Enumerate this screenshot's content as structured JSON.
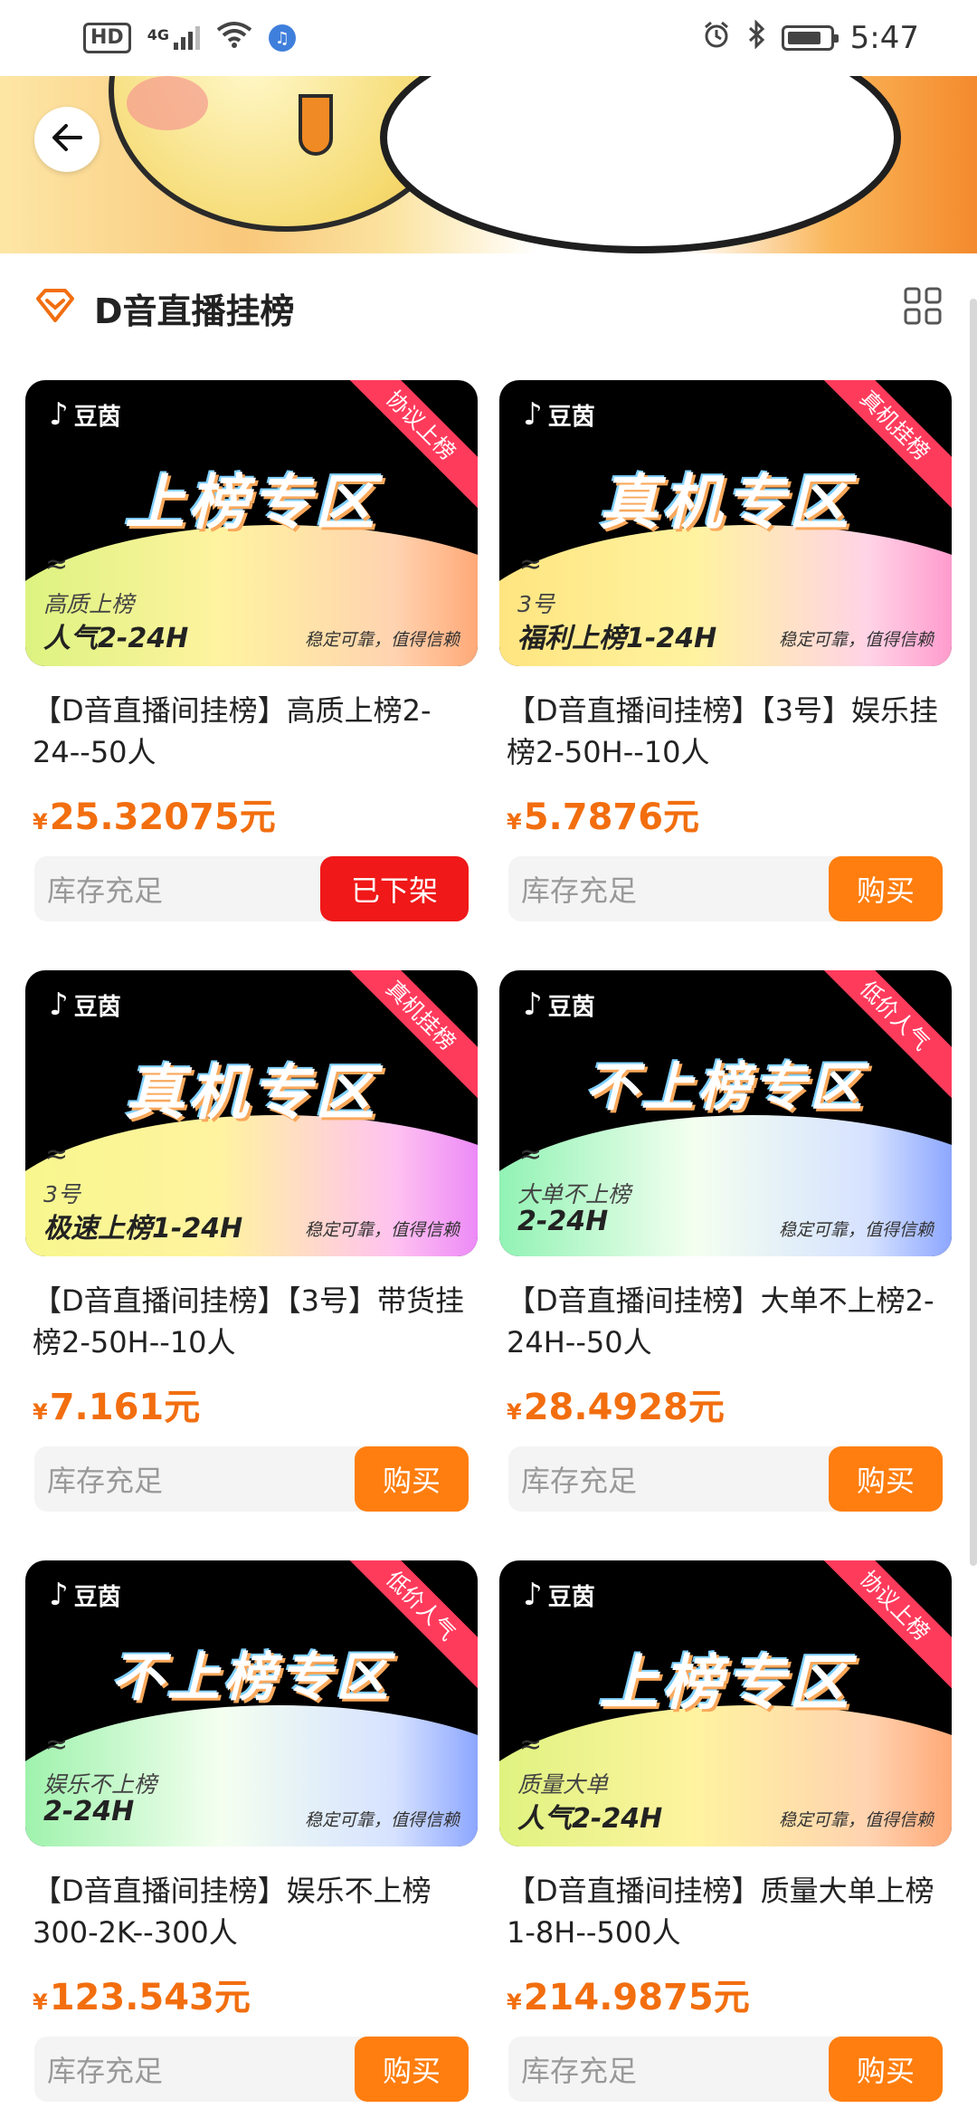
{
  "status_bar": {
    "left_icons": [
      "hd-icon",
      "signal-4g-icon",
      "wifi-icon",
      "music-app-icon"
    ],
    "hd": "HD",
    "network": "4G",
    "time": "5:47",
    "right_icons": [
      "alarm-icon",
      "bluetooth-icon",
      "battery-icon"
    ]
  },
  "header": {
    "back": "back-arrow-icon"
  },
  "section": {
    "title": "D音直播挂榜",
    "view_toggle": "grid-view-icon"
  },
  "products": [
    {
      "thumb": {
        "logo": "豆茵",
        "zone": "上榜专区",
        "ribbon": "协议上榜",
        "sub": "高质上榜",
        "main": "人气2-24H",
        "trust": "稳定可靠，值得信赖",
        "wave_color": "#d6f37a"
      },
      "name": "【D音直播间挂榜】高质上榜2-24--50人",
      "price": "25.32075元",
      "stock": "库存充足",
      "button": "已下架",
      "button_type": "off"
    },
    {
      "thumb": {
        "logo": "豆茵",
        "zone": "真机专区",
        "ribbon": "真机挂榜",
        "sub": "3号",
        "main": "福利上榜1-24H",
        "trust": "稳定可靠，值得信赖",
        "wave_color": "#ffe27a"
      },
      "name": "【D音直播间挂榜】【3号】娱乐挂榜2-50H--10人",
      "price": "5.7876元",
      "stock": "库存充足",
      "button": "购买",
      "button_type": "buy"
    },
    {
      "thumb": {
        "logo": "豆茵",
        "zone": "真机专区",
        "ribbon": "真机挂榜",
        "sub": "3号",
        "main": "极速上榜1-24H",
        "trust": "稳定可靠，值得信赖",
        "wave_color": "#f6f88a"
      },
      "name": "【D音直播间挂榜】【3号】带货挂榜2-50H--10人",
      "price": "7.161元",
      "stock": "库存充足",
      "button": "购买",
      "button_type": "buy"
    },
    {
      "thumb": {
        "logo": "豆茵",
        "zone": "不上榜专区",
        "ribbon": "低价人气",
        "sub": "大单不上榜",
        "main": "2-24H",
        "trust": "稳定可靠，值得信赖",
        "wave_color": "#7ff0a9"
      },
      "name": "【D音直播间挂榜】大单不上榜2-24H--50人",
      "price": "28.4928元",
      "stock": "库存充足",
      "button": "购买",
      "button_type": "buy"
    },
    {
      "thumb": {
        "logo": "豆茵",
        "zone": "不上榜专区",
        "ribbon": "低价人气",
        "sub": "娱乐不上榜",
        "main": "2-24H",
        "trust": "稳定可靠，值得信赖",
        "wave_color": "#8ff0a0"
      },
      "name": "【D音直播间挂榜】娱乐不上榜300-2K--300人",
      "price": "123.543元",
      "stock": "库存充足",
      "button": "购买",
      "button_type": "buy"
    },
    {
      "thumb": {
        "logo": "豆茵",
        "zone": "上榜专区",
        "ribbon": "协议上榜",
        "sub": "质量大单",
        "main": "人气2-24H",
        "trust": "稳定可靠，值得信赖",
        "wave_color": "#d9f37a"
      },
      "name": "【D音直播间挂榜】质量大单上榜1-8H--500人",
      "price": "214.9875元",
      "stock": "库存充足",
      "button": "购买",
      "button_type": "buy"
    }
  ],
  "currency_symbol": "¥",
  "colors": {
    "accent_orange": "#ff7e0f",
    "price_orange": "#f26e0f",
    "off_red": "#f01818",
    "ribbon_pink": "#ff3b5c"
  }
}
